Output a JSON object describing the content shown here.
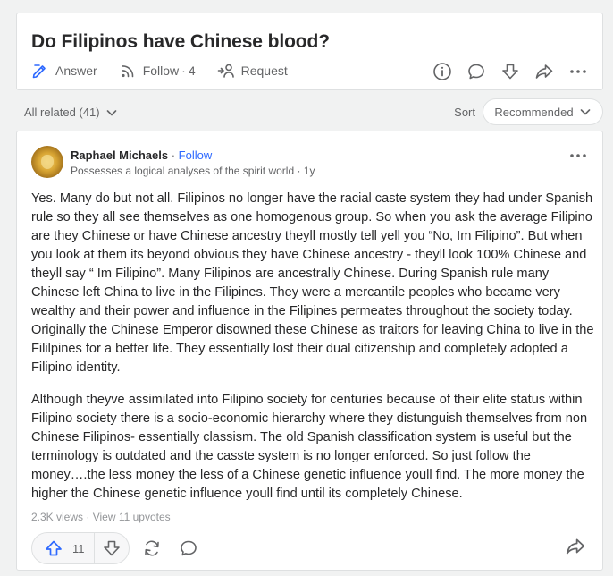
{
  "question": {
    "title": "Do Filipinos have Chinese blood?",
    "actions": {
      "answer_label": "Answer",
      "follow_label": "Follow",
      "follow_separator": "·",
      "follow_count": "4",
      "request_label": "Request"
    },
    "right_icons": [
      "info-icon",
      "comment-icon",
      "downvote-icon",
      "share-icon",
      "more-icon"
    ]
  },
  "related": {
    "label": "All related (41)",
    "sort_label": "Sort",
    "sort_value": "Recommended"
  },
  "answer": {
    "author": {
      "name": "Raphael Michaels",
      "separator": " · ",
      "follow_label": "Follow",
      "credential": "Possesses a logical analyses of the spirit world",
      "time_separator": " · ",
      "time": "1y"
    },
    "paragraphs": [
      "Yes. Many do but not all. Filipinos no longer have the racial caste system they had under Spanish rule so they all see themselves as one homogenous group. So when you ask the average Filipino are they Chinese or have Chinese ancestry theyll mostly tell yell you “No, Im Filipino”. But when you look at them its beyond obvious they have Chinese ancestry - theyll look 100% Chinese and theyll say “ Im Filipino”. Many Filipinos are ancestrally Chinese. During Spanish rule many Chinese left China to live in the Filipines. They were a mercantile peoples who became very wealthy and their power and influence in the Filipines permeates throughout the society today. Originally the Chinese Emperor disowned these Chinese as traitors for leaving China to live in the Fililpines for a better life. They essentially lost their dual citizenship and completely adopted a Filipino identity.",
      "Although theyve assimilated into Filipino society for centuries because of their elite status within Filipino society there is a socio-economic hierarchy where they distunguish themselves from non Chinese Filipinos- essentially classism. The old Spanish classification system is useful but the terminology is outdated and the casste system is no longer enforced. So just follow the money….the less money the less of a Chinese genetic influence youll find. The more money the higher the Chinese genetic influence youll find until its completely Chinese."
    ],
    "views": "2.3K views",
    "stats_separator": " · ",
    "upvotes_link": "View 11 upvotes",
    "upvote_count": "11"
  },
  "colors": {
    "background": "#f1f2f2",
    "card": "#ffffff",
    "text": "#282829",
    "secondary_text": "#636466",
    "link_blue": "#2e69ff",
    "upvote_blue": "#2e69ff"
  }
}
